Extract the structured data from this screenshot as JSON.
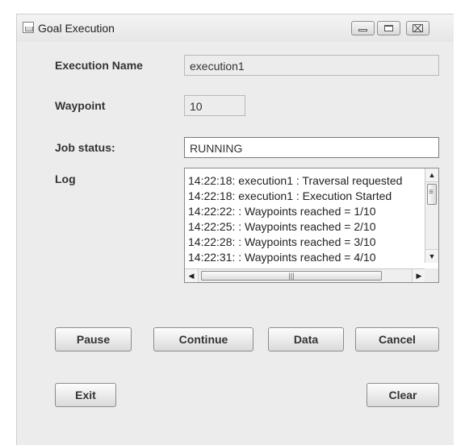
{
  "window": {
    "title": "Goal Execution",
    "icon": "java-cup-icon",
    "controls": {
      "minimize": "minimize-icon",
      "maximize": "maximize-icon",
      "close": "close-icon",
      "close_glyph": "⌧"
    }
  },
  "form": {
    "execution_name_label": "Execution Name",
    "execution_name_value": "execution1",
    "waypoint_label": "Waypoint",
    "waypoint_value": "10",
    "job_status_label": "Job status:",
    "job_status_value": "RUNNING",
    "log_label": "Log"
  },
  "log": {
    "lines": [
      "14:22:18: execution1 : Traversal requested",
      "14:22:18: execution1 : Execution Started",
      "14:22:22: : Waypoints reached = 1/10",
      "14:22:25: : Waypoints reached = 2/10",
      "14:22:28: : Waypoints reached = 3/10",
      "14:22:31: : Waypoints reached = 4/10"
    ]
  },
  "buttons": {
    "pause": "Pause",
    "continue": "Continue",
    "data": "Data",
    "cancel": "Cancel",
    "exit": "Exit",
    "clear": "Clear"
  }
}
